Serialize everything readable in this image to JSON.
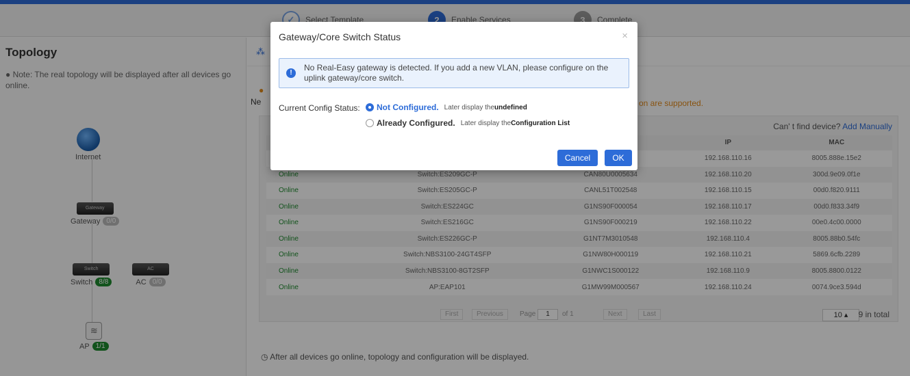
{
  "steps": [
    {
      "label": "Select Template",
      "index": "✓"
    },
    {
      "label": "Enable Services",
      "index": "2"
    },
    {
      "label": "Complete",
      "index": "3"
    }
  ],
  "topology": {
    "title": "Topology",
    "note": "Note: The real topology will be displayed after all devices go online.",
    "nodes": {
      "internet": "Internet",
      "gateway": {
        "label": "Gateway",
        "device_text": "Gateway",
        "count": "0/0"
      },
      "switch": {
        "label": "Switch",
        "device_text": "Switch",
        "count": "8/8"
      },
      "ac": {
        "label": "AC",
        "device_text": "AC",
        "count": "0/0"
      },
      "ap": {
        "label": "AP",
        "count": "1/1"
      }
    }
  },
  "main": {
    "tab_icon": "topology-icon",
    "ne_prefix": "Ne",
    "orange_text": "on are supported.",
    "cant_find": "Can' t find device?",
    "add_manually": "Add Manually",
    "table": {
      "headers": [
        "",
        "",
        "",
        "IP",
        "MAC"
      ],
      "rows": [
        [
          "Online",
          "Switch:ES209GC-P",
          "CAN80U0005634",
          "192.168.110.20",
          "300d.9e09.0f1e"
        ],
        [
          "Online",
          "Switch:ES205GC-P",
          "CANL51T002548",
          "192.168.110.15",
          "00d0.f820.9111"
        ],
        [
          "Online",
          "Switch:ES224GC",
          "G1NS90F000054",
          "192.168.110.17",
          "00d0.f833.34f9"
        ],
        [
          "Online",
          "Switch:ES216GC",
          "G1NS90F000219",
          "192.168.110.22",
          "00e0.4c00.0000"
        ],
        [
          "Online",
          "Switch:ES226GC-P",
          "G1NT7M3010548",
          "192.168.110.4",
          "8005.88b0.54fc"
        ],
        [
          "Online",
          "Switch:NBS3100-24GT4SFP",
          "G1NW80H000119",
          "192.168.110.21",
          "5869.6cfb.2289"
        ],
        [
          "Online",
          "Switch:NBS3100-8GT2SFP",
          "G1NWC1S000122",
          "192.168.110.9",
          "8005.8800.0122"
        ],
        [
          "Online",
          "AP:EAP101",
          "G1MW99M000567",
          "192.168.110.24",
          "0074.9ce3.594d"
        ]
      ],
      "first_row_ip": "192.168.110.16",
      "first_row_mac": "8005.888e.15e2"
    },
    "pager": {
      "first": "First",
      "previous": "Previous",
      "page_label": "Page",
      "page_value": "1",
      "of": "of 1",
      "next": "Next",
      "last": "Last",
      "page_size": "10 ▴",
      "total": "9 in total"
    },
    "footnote": "After all devices go online, topology and configuration will be displayed."
  },
  "modal": {
    "title": "Gateway/Core Switch Status",
    "close": "×",
    "info": "No Real-Easy gateway is detected. If you add a new VLAN, please configure on the uplink gateway/core switch.",
    "config_label": "Current Config Status:",
    "options": [
      {
        "label": "Not Configured.",
        "desc_prefix": "Later display the",
        "desc_bold": "undefined",
        "selected": true
      },
      {
        "label": "Already Configured.",
        "desc_prefix": "Later display the",
        "desc_bold": "Configuration List",
        "selected": false
      }
    ],
    "cancel": "Cancel",
    "ok": "OK"
  },
  "colors": {
    "accent": "#2d6cd8",
    "online": "#1f8a2f",
    "warning": "#e38a1b"
  }
}
